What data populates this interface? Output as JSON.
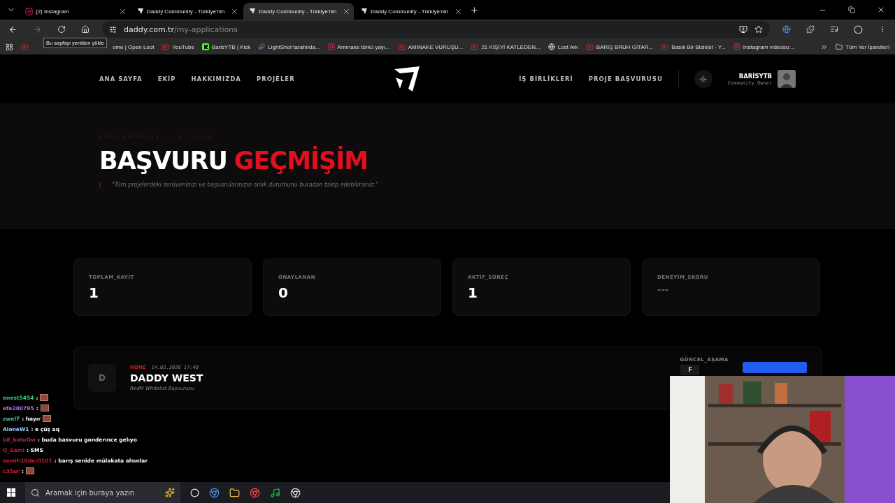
{
  "browser": {
    "tabs": [
      {
        "title": "(2) Instagram",
        "kind": "instagram",
        "selected": false
      },
      {
        "title": "Daddy Community - Türkiye'nin",
        "kind": "site",
        "selected": false
      },
      {
        "title": "Daddy Community - Türkiye'nin",
        "kind": "site",
        "selected": true
      },
      {
        "title": "Daddy Community - Türkiye'nin",
        "kind": "site",
        "selected": false
      }
    ],
    "url": {
      "domain": "daddy.com.tr",
      "path": "/my-applications"
    },
    "tooltip": "Bu sayfayı yeniden yükle",
    "bookmarks": [
      {
        "label": "ome | Open Loot",
        "kind": "none"
      },
      {
        "label": "YouTube",
        "kind": "youtube"
      },
      {
        "label": "BarisYTB | Kick",
        "kind": "kick"
      },
      {
        "label": "LightShot tarafında...",
        "kind": "feather"
      },
      {
        "label": "Amınake türkü yayı...",
        "kind": "instagram"
      },
      {
        "label": "AMINAKE VURUŞU...",
        "kind": "youtube"
      },
      {
        "label": "21 KİŞİYİ KATLEDEN...",
        "kind": "youtube"
      },
      {
        "label": "Lost Ark",
        "kind": "globe"
      },
      {
        "label": "BARIŞ BRUH GİTAR...",
        "kind": "youtube"
      },
      {
        "label": "Basık Bir Bisiklet - Y...",
        "kind": "youtube"
      },
      {
        "label": "Instagram videosu:...",
        "kind": "instagram"
      }
    ],
    "all_bookmarks": "Tüm Yer İşaretleri"
  },
  "nav": {
    "left": [
      "ANA SAYFA",
      "EKİP",
      "HAKKIMIZDA",
      "PROJELER"
    ],
    "right": [
      "İŞ BİRLİKLERİ",
      "PROJE BAŞVURUSU"
    ],
    "user": {
      "name": "BARİSYTB",
      "role": "Community Owner"
    }
  },
  "hero": {
    "breadcrumb": "USER_ARCHIVES // MY_LOGS",
    "title": "BAŞVURU",
    "title_accent": "GEÇMİŞİM",
    "subtitle": "\"Tüm projelerdeki serüveninizi ve başvurularınızın anlık durumunu buradan takip edebilirsiniz.\""
  },
  "stats": [
    {
      "label": "TOPLAM_KAYIT",
      "value": "1",
      "muted": false
    },
    {
      "label": "ONAYLANAN",
      "value": "0",
      "muted": false
    },
    {
      "label": "AKTİF_SÜREÇ",
      "value": "1",
      "muted": false
    },
    {
      "label": "DENEYİM_SKORU",
      "value": "---",
      "muted": true
    }
  ],
  "application": {
    "initial": "D",
    "status": "NONE",
    "date": "14.02.2026 17:48",
    "name": "DADDY WEST",
    "subtitle": "RedM Whitelist Başvurusu",
    "stage_label": "GÜNCEL_AŞAMA",
    "stage": "F"
  },
  "chat": [
    {
      "user": "enest5454",
      "color": "#2fd47f",
      "text": ":",
      "emote": true
    },
    {
      "user": "efe200795",
      "color": "#b06ee8",
      "text": ":",
      "emote": true
    },
    {
      "user": "zwel7",
      "color": "#4fc0a0",
      "text": ": hayır",
      "emote": true
    },
    {
      "user": "AloneW1",
      "color": "#a9c8ff",
      "text": ": e çüş aq",
      "emote": false
    },
    {
      "user": "b8_batuQw",
      "color": "#c0203a",
      "text": ": buda basvuru gonderınce gelıyo",
      "emote": false
    },
    {
      "user": "Q_Sami",
      "color": "#c0203a",
      "text": ": SMS",
      "emote": false
    },
    {
      "user": "semih10der0101",
      "color": "#c0203a",
      "text": ": barış senide mülakata alsınlar",
      "emote": false
    },
    {
      "user": "c35ur",
      "color": "#c0203a",
      "text": ":",
      "emote": true
    }
  ],
  "taskbar": {
    "search_placeholder": "Aramak için buraya yazın"
  }
}
